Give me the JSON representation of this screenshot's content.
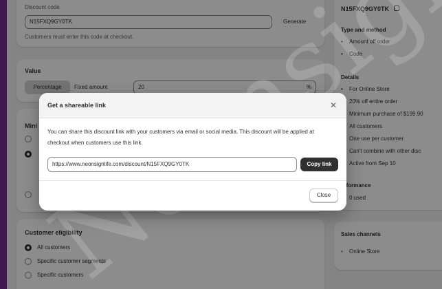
{
  "discount_code": {
    "label": "Discount code",
    "value": "N15FXQ9GY0TK",
    "generate_label": "Generate",
    "help": "Customers must enter this code at checkout."
  },
  "value_section": {
    "label": "Value",
    "percentage_tab": "Percentage",
    "fixed_tab": "Fixed amount",
    "amount": "20",
    "suffix": "%"
  },
  "minimum_section": {
    "label": "Mini"
  },
  "eligibility": {
    "label": "Customer eligibility",
    "options": [
      "All customers",
      "Specific customer segments",
      "Specific customers"
    ]
  },
  "summary": {
    "code": "N15FXQ9GY0TK",
    "type_label": "Type and method",
    "type_items": [
      "Amount off order",
      "Code"
    ],
    "details_label": "Details",
    "details_items": [
      "For Online Store",
      "20% off entire order",
      "Minimum purchase of $199.90",
      "All customers",
      "One use per customer",
      "Can't combine with other disc",
      "Active from Sep 10"
    ],
    "performance_label": "erformance",
    "performance_value": "0 used"
  },
  "sales_channels": {
    "label": "Sales channels",
    "item": "Online Store"
  },
  "modal": {
    "title": "Get a shareable link",
    "body": "You can share this discount link with your customers via email or social media. This discount will be applied at checkout when customers use this link.",
    "link": "https://www.neonsignlife.com/discount/N15FXQ9GY0TK",
    "copy_label": "Copy link",
    "close_label": "Close"
  },
  "watermark": "Neonsign"
}
